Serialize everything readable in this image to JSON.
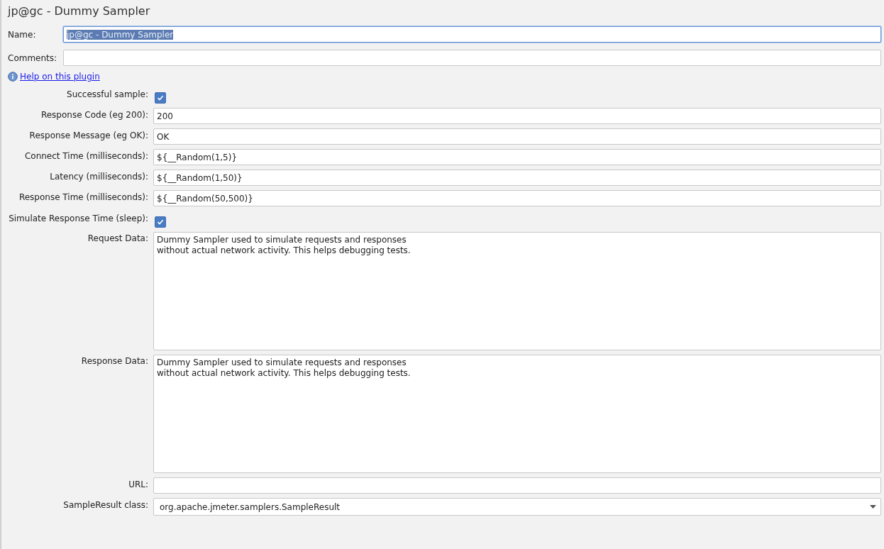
{
  "title": "jp@gc - Dummy Sampler",
  "name_field": {
    "label": "Name:",
    "value": "jp@gc - Dummy Sampler",
    "selected": true
  },
  "comments_field": {
    "label": "Comments:"
  },
  "help_link": "Help on this plugin",
  "fields": [
    {
      "kind": "checkbox",
      "label": "Successful sample:",
      "checked": true
    },
    {
      "kind": "text",
      "label": "Response Code (eg 200):",
      "value": "200"
    },
    {
      "kind": "text",
      "label": "Response Message (eg OK):",
      "value": "OK"
    },
    {
      "kind": "text",
      "label": "Connect Time (milliseconds):",
      "value": "${__Random(1,5)}"
    },
    {
      "kind": "text",
      "label": "Latency (milliseconds):",
      "value": "${__Random(1,50)}"
    },
    {
      "kind": "text",
      "label": "Response Time (milliseconds):",
      "value": "${__Random(50,500)}"
    },
    {
      "kind": "checkbox",
      "label": "Simulate Response Time (sleep):",
      "checked": true
    },
    {
      "kind": "textarea",
      "label": "Request Data:",
      "value": "Dummy Sampler used to simulate requests and responses\nwithout actual network activity. This helps debugging tests."
    },
    {
      "kind": "textarea",
      "label": "Response Data:",
      "value": "Dummy Sampler used to simulate requests and responses\nwithout actual network activity. This helps debugging tests."
    },
    {
      "kind": "text",
      "label": "URL:"
    },
    {
      "kind": "select",
      "label": "SampleResult class:",
      "value": "org.apache.jmeter.samplers.SampleResult"
    }
  ]
}
